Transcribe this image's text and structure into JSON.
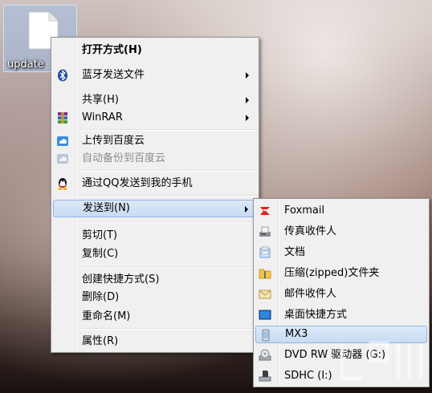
{
  "desktop_file": {
    "label": "update"
  },
  "context_menu": {
    "items": [
      {
        "label": "打开方式(H)",
        "icon": "none",
        "bold": true
      },
      {
        "label": "蓝牙发送文件",
        "icon": "bluetooth-icon",
        "submenu": true
      },
      {
        "label": "共享(H)",
        "icon": "none",
        "submenu": true
      },
      {
        "label": "WinRAR",
        "icon": "winrar-icon",
        "submenu": true
      },
      {
        "label": "上传到百度云",
        "icon": "baidu-cloud-icon"
      },
      {
        "label": "自动备份到百度云",
        "icon": "baidu-cloud-backup-icon",
        "disabled": true
      },
      {
        "label": "通过QQ发送到我的手机",
        "icon": "qq-icon"
      },
      {
        "label": "发送到(N)",
        "icon": "none",
        "submenu": true,
        "highlighted": true
      },
      {
        "label": "剪切(T)"
      },
      {
        "label": "复制(C)"
      },
      {
        "label": "创建快捷方式(S)"
      },
      {
        "label": "删除(D)"
      },
      {
        "label": "重命名(M)"
      },
      {
        "label": "属性(R)"
      }
    ]
  },
  "send_to_menu": {
    "items": [
      {
        "label": "Foxmail",
        "icon": "foxmail-icon"
      },
      {
        "label": "传真收件人",
        "icon": "fax-icon"
      },
      {
        "label": "文档",
        "icon": "documents-icon"
      },
      {
        "label": "压缩(zipped)文件夹",
        "icon": "zip-folder-icon"
      },
      {
        "label": "邮件收件人",
        "icon": "mail-recipient-icon"
      },
      {
        "label": "桌面快捷方式",
        "icon": "desktop-shortcut-icon"
      },
      {
        "label": "MX3",
        "icon": "phone-icon",
        "highlighted": true
      },
      {
        "label": "DVD RW 驱动器 (G:)",
        "icon": "dvd-drive-icon"
      },
      {
        "label": "SDHC (I:)",
        "icon": "sd-card-icon"
      }
    ]
  },
  "colors": {
    "menu_bg": "#f0f0f0",
    "highlight": "#c6dbf3",
    "highlight_border": "#8fb5e4"
  }
}
